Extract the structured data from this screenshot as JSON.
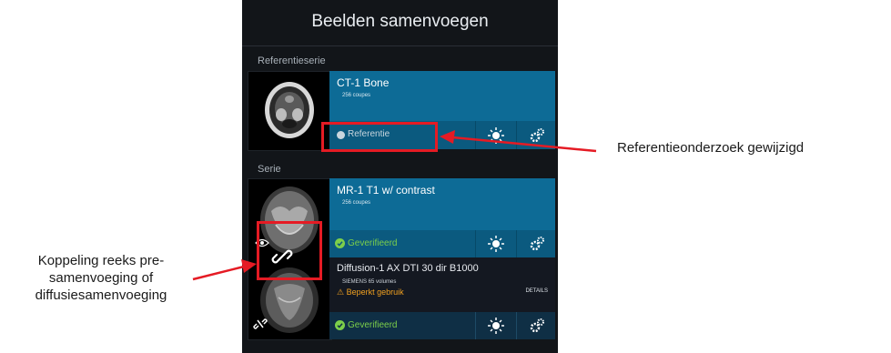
{
  "panel": {
    "title": "Beelden samenvoegen",
    "reference_section_label": "Referentieserie",
    "series_section_label": "Serie"
  },
  "reference_card": {
    "name": "CT-1 Bone",
    "subtitle": "256 coupes",
    "status": "Referentie"
  },
  "mr_card": {
    "name": "MR-1 T1 w/ contrast",
    "subtitle": "256 coupes",
    "status": "Geverifieerd"
  },
  "diffusion_card": {
    "name": "Diffusion-1 AX DTI 30 dir B1000",
    "subtitle": "SIEMENS 65 volumes",
    "warning": "Beperkt gebruik",
    "details_label": "DETAILS",
    "status": "Geverifieerd"
  },
  "callouts": {
    "reference_changed": "Referentieonderzoek gewijzigd",
    "link_line1": "Koppeling reeks pre-",
    "link_line2": "samenvoeging of",
    "link_line3": "diffusiesamenvoeging"
  },
  "colors": {
    "panel_bg": "#121519",
    "card_blue": "#0d6b96",
    "bar_blue": "#0b5a7f",
    "verified_green": "#7ccf4a",
    "warning_orange": "#f0a020",
    "highlight_red": "#e51b24"
  },
  "icons": {
    "brightness": "brightness-icon",
    "settings": "gears-icon",
    "link": "link-icon",
    "verified": "check-circle-icon",
    "warning": "warning-triangle-icon",
    "eye": "eye-icon",
    "unlink": "unlink-icon"
  }
}
